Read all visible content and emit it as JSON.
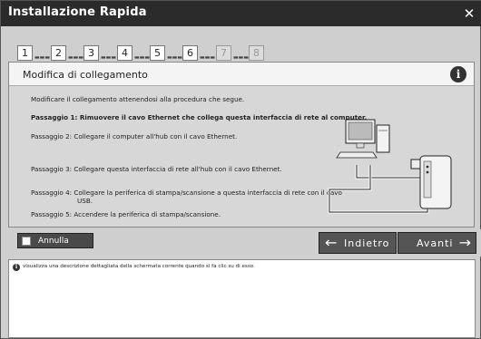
{
  "window": {
    "title": "Installazione Rapida",
    "close_glyph": "✕"
  },
  "steps": [
    {
      "num": "1",
      "dots": "▬▬▬",
      "active": true
    },
    {
      "num": "2",
      "dots": "▬▬▬",
      "active": true
    },
    {
      "num": "3",
      "dots": "▬▬▬",
      "active": true
    },
    {
      "num": "4",
      "dots": "▬▬▬",
      "active": true
    },
    {
      "num": "5",
      "dots": "▬▬▬",
      "active": true
    },
    {
      "num": "6",
      "dots": "▬▬▬",
      "active": true
    },
    {
      "num": "7",
      "dots": "▬▬▬",
      "active": false
    },
    {
      "num": "8",
      "dots": "",
      "active": false
    }
  ],
  "panel": {
    "title": "Modifica di collegamento",
    "info_glyph": "i",
    "intro": "Modificare il collegamento attenendosi alla procedura che segue.",
    "step1": "Passaggio 1: Rimuovere il cavo Ethernet che collega questa interfaccia di rete al computer.",
    "step2": "Passaggio 2:  Collegare il computer all'hub con il cavo Ethernet.",
    "step3": "Passaggio 3:  Collegare questa interfaccia di rete all'hub con il cavo Ethernet.",
    "step4_line1": "Passaggio 4:  Collegare la periferica di stampa/scansione a questa interfaccia di rete con il cavo",
    "step4_line2": "USB.",
    "step5": "Passaggio 5:  Accendere la periferica di stampa/scansione."
  },
  "buttons": {
    "cancel": "Annulla",
    "back": "Indietro",
    "back_arrow": "←",
    "next": "Avanti",
    "next_arrow": "→"
  },
  "description": {
    "icon_glyph": "i",
    "text": "visualizza una descrizione dettagliata della schermata corrente quando si fa clic su di esso."
  }
}
